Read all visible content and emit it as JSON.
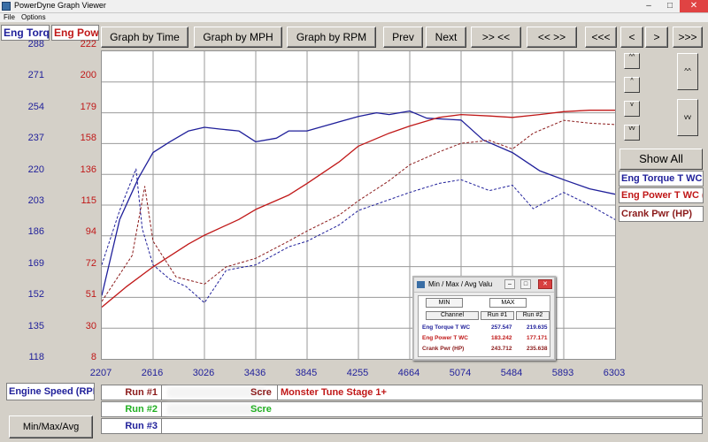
{
  "window": {
    "title": "PowerDyne Graph Viewer",
    "minimize": "–",
    "maximize": "□",
    "close": "✕"
  },
  "menu": {
    "file": "File",
    "options": "Options"
  },
  "axes": {
    "torque": {
      "label": "Eng Torque",
      "ticks": [
        "288",
        "271",
        "254",
        "237",
        "220",
        "203",
        "186",
        "169",
        "152",
        "135",
        "118"
      ]
    },
    "power": {
      "label": "Eng Powe",
      "ticks": [
        "222",
        "200",
        "179",
        "158",
        "136",
        "115",
        "94",
        "72",
        "51",
        "30",
        "8"
      ]
    },
    "x_ticks": [
      "2207",
      "2616",
      "3026",
      "3436",
      "3845",
      "4255",
      "4664",
      "5074",
      "5484",
      "5893",
      "6303"
    ]
  },
  "toolbar": {
    "graph_by_time": "Graph by Time",
    "graph_by_mph": "Graph by MPH",
    "graph_by_rpm": "Graph by RPM",
    "prev": "Prev",
    "next": "Next",
    "zoom_in": ">> <<",
    "zoom_out": "<< >>",
    "scroll_far_left": "<<<",
    "scroll_left": "<",
    "scroll_right": ">",
    "scroll_far_right": ">>>"
  },
  "controls": {
    "scale_up_fast": "^^",
    "scale_up": "^",
    "scale_down": "v",
    "scale_down_fast": "vv",
    "side_up": "^^",
    "side_down": "vv",
    "show_all": "Show All"
  },
  "legend": [
    {
      "label": "Eng Torque T WC",
      "color": "#1f1f9a"
    },
    {
      "label": "Eng Power T WC (",
      "color": "#c01818"
    },
    {
      "label": "Crank Pwr (HP)",
      "color": "#8b1a1a"
    }
  ],
  "bottom": {
    "x_label": "Engine Speed (RPM",
    "minmax_button": "Min/Max/Avg",
    "runs": [
      {
        "label": "Run #1",
        "color": "#8b1a1a",
        "screen": "Scre",
        "description": "Monster Tune Stage 1+"
      },
      {
        "label": "Run #2",
        "color": "#22b022",
        "screen": "Scre",
        "description": ""
      },
      {
        "label": "Run #3",
        "color": "#1f1f9a",
        "screen": "",
        "description": ""
      }
    ]
  },
  "dialog": {
    "title": "Min / Max / Avg Valu",
    "tab_min": "MIN",
    "tab_max": "MAX",
    "headers": [
      "Channel",
      "Run #1",
      "Run #2"
    ],
    "rows": [
      {
        "channel": "Eng Torque T WC",
        "run1": "257.547",
        "run2": "219.635",
        "color": "#1f1f9a"
      },
      {
        "channel": "Eng Power T WC",
        "run1": "183.242",
        "run2": "177.171",
        "color": "#c01818"
      },
      {
        "channel": "Crank Pwr (HP)",
        "run1": "243.712",
        "run2": "235.638",
        "color": "#8b1a1a"
      }
    ]
  },
  "chart_data": {
    "type": "line",
    "xlabel": "Engine Speed (RPM",
    "xlim": [
      2207,
      6303
    ],
    "ylim_left": [
      118,
      288
    ],
    "ylim_right": [
      8,
      222
    ],
    "grid": true,
    "series": [
      {
        "name": "Eng Torque T WC",
        "run": "Run #1",
        "axis": "left",
        "color": "#1f1f9a",
        "dash": "solid",
        "x": [
          2207,
          2350,
          2500,
          2616,
          2750,
          2900,
          3026,
          3150,
          3300,
          3436,
          3600,
          3700,
          3845,
          4000,
          4255,
          4400,
          4500,
          4664,
          4800,
          5074,
          5250,
          5484,
          5700,
          5893,
          6100,
          6303
        ],
        "y": [
          153,
          195,
          218,
          232,
          238,
          244,
          246,
          245,
          244,
          238,
          240,
          244,
          244,
          247,
          252,
          254,
          253,
          255,
          251,
          250,
          239,
          232,
          222,
          217,
          212,
          209
        ]
      },
      {
        "name": "Eng Torque T WC",
        "run": "Run #2",
        "axis": "left",
        "color": "#1f1f9a",
        "dash": "dashed",
        "x": [
          2207,
          2350,
          2480,
          2530,
          2616,
          2750,
          2880,
          3026,
          3200,
          3436,
          3700,
          3845,
          4100,
          4255,
          4500,
          4664,
          4900,
          5074,
          5300,
          5484,
          5650,
          5893,
          6100,
          6303
        ],
        "y": [
          170,
          200,
          223,
          190,
          170,
          162,
          158,
          149,
          167,
          170,
          180,
          183,
          192,
          200,
          206,
          210,
          215,
          217,
          211,
          214,
          201,
          210,
          203,
          195
        ]
      },
      {
        "name": "Eng Power T WC",
        "run": "Run #1",
        "axis": "right",
        "color": "#c01818",
        "dash": "solid",
        "x": [
          2207,
          2400,
          2616,
          2900,
          3026,
          3300,
          3436,
          3700,
          3845,
          4100,
          4255,
          4500,
          4664,
          4900,
          5074,
          5300,
          5484,
          5700,
          5893,
          6100,
          6303
        ],
        "y": [
          44,
          58,
          72,
          88,
          94,
          105,
          112,
          122,
          130,
          145,
          156,
          165,
          170,
          176,
          178,
          177,
          176,
          178,
          180,
          181,
          181
        ]
      },
      {
        "name": "Eng Power T WC",
        "run": "Run #2",
        "axis": "right",
        "color": "#8b1a1a",
        "dash": "dashed",
        "x": [
          2207,
          2450,
          2550,
          2616,
          2800,
          3026,
          3200,
          3436,
          3700,
          3845,
          4100,
          4255,
          4500,
          4664,
          4900,
          5074,
          5300,
          5484,
          5650,
          5893,
          6100,
          6303
        ],
        "y": [
          48,
          80,
          128,
          90,
          65,
          60,
          72,
          78,
          90,
          97,
          108,
          118,
          132,
          143,
          152,
          158,
          160,
          154,
          165,
          174,
          172,
          171
        ]
      }
    ]
  }
}
